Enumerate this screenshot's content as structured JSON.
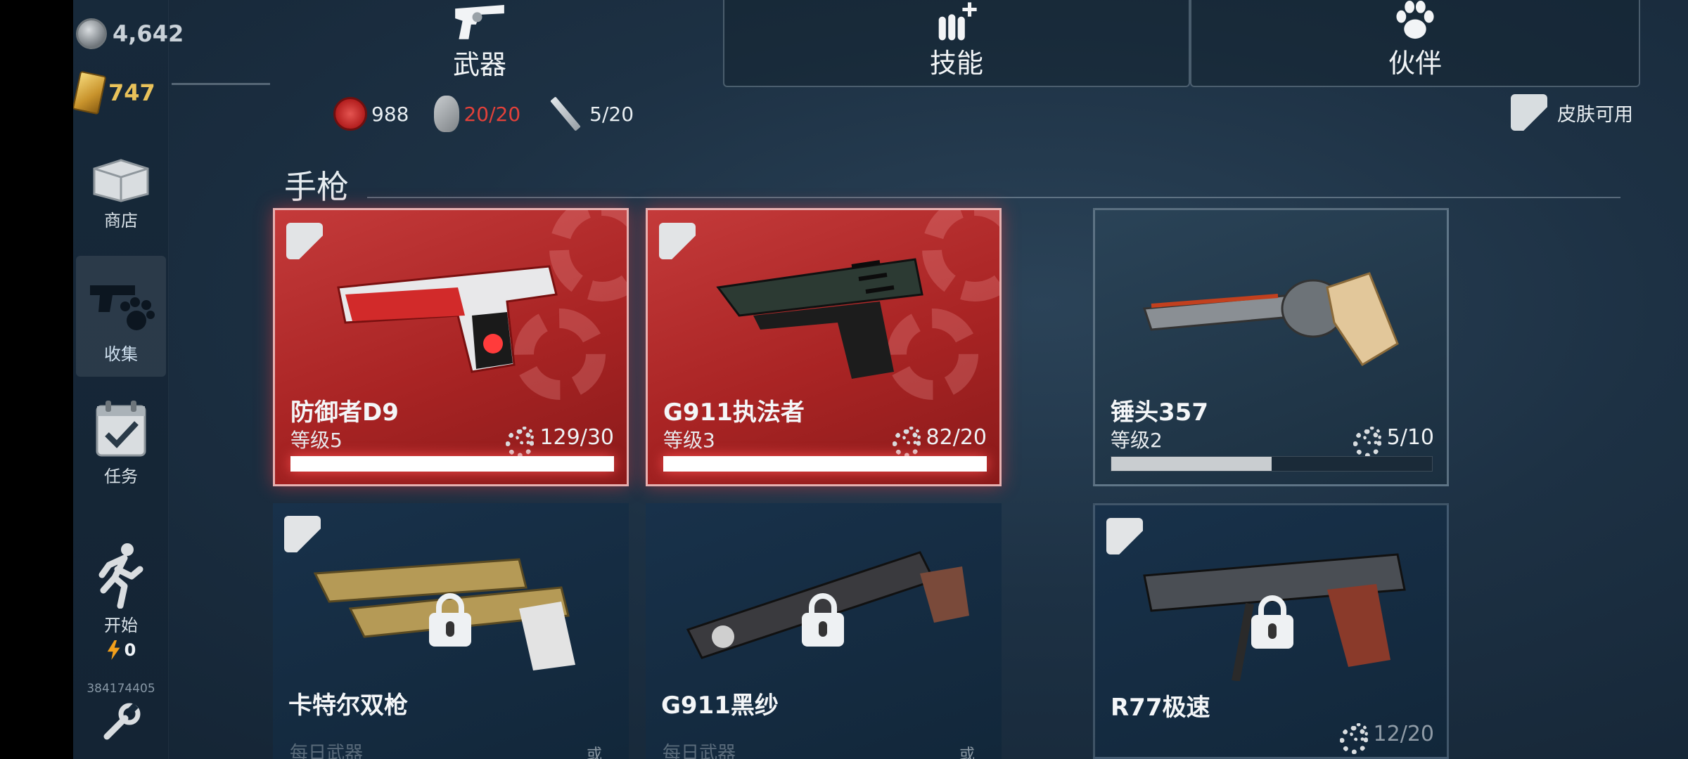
{
  "currency": {
    "silver": "4,642",
    "gold": "747"
  },
  "sidebar": {
    "items": [
      {
        "label": "商店"
      },
      {
        "label": "收集"
      },
      {
        "label": "任务"
      },
      {
        "label": "开始",
        "energy": "0"
      }
    ],
    "player_id": "384174405"
  },
  "tabs": {
    "weapons": "武器",
    "skills": "技能",
    "partner": "伙伴"
  },
  "resources": {
    "badge": "988",
    "grenade": "20/20",
    "knife": "5/20"
  },
  "skins_available": "皮肤可用",
  "section": {
    "title": "手枪"
  },
  "cards": [
    {
      "name": "防御者D9",
      "level": "等级5",
      "parts": "129/30",
      "progress": 1.0
    },
    {
      "name": "G911执法者",
      "level": "等级3",
      "parts": "82/20",
      "progress": 1.0
    },
    {
      "name": "锤头357",
      "level": "等级2",
      "parts": "5/10",
      "progress": 0.5
    },
    {
      "name": "卡特尔双枪",
      "daily": "每日武器",
      "or": "或"
    },
    {
      "name": "G911黑纱",
      "daily": "每日武器",
      "or": "或"
    },
    {
      "name": "R77极速",
      "parts": "12/20"
    }
  ],
  "colors": {
    "accent_red": "#c43a3a",
    "warning_red": "#e2413a",
    "gold": "#e9c25a"
  }
}
